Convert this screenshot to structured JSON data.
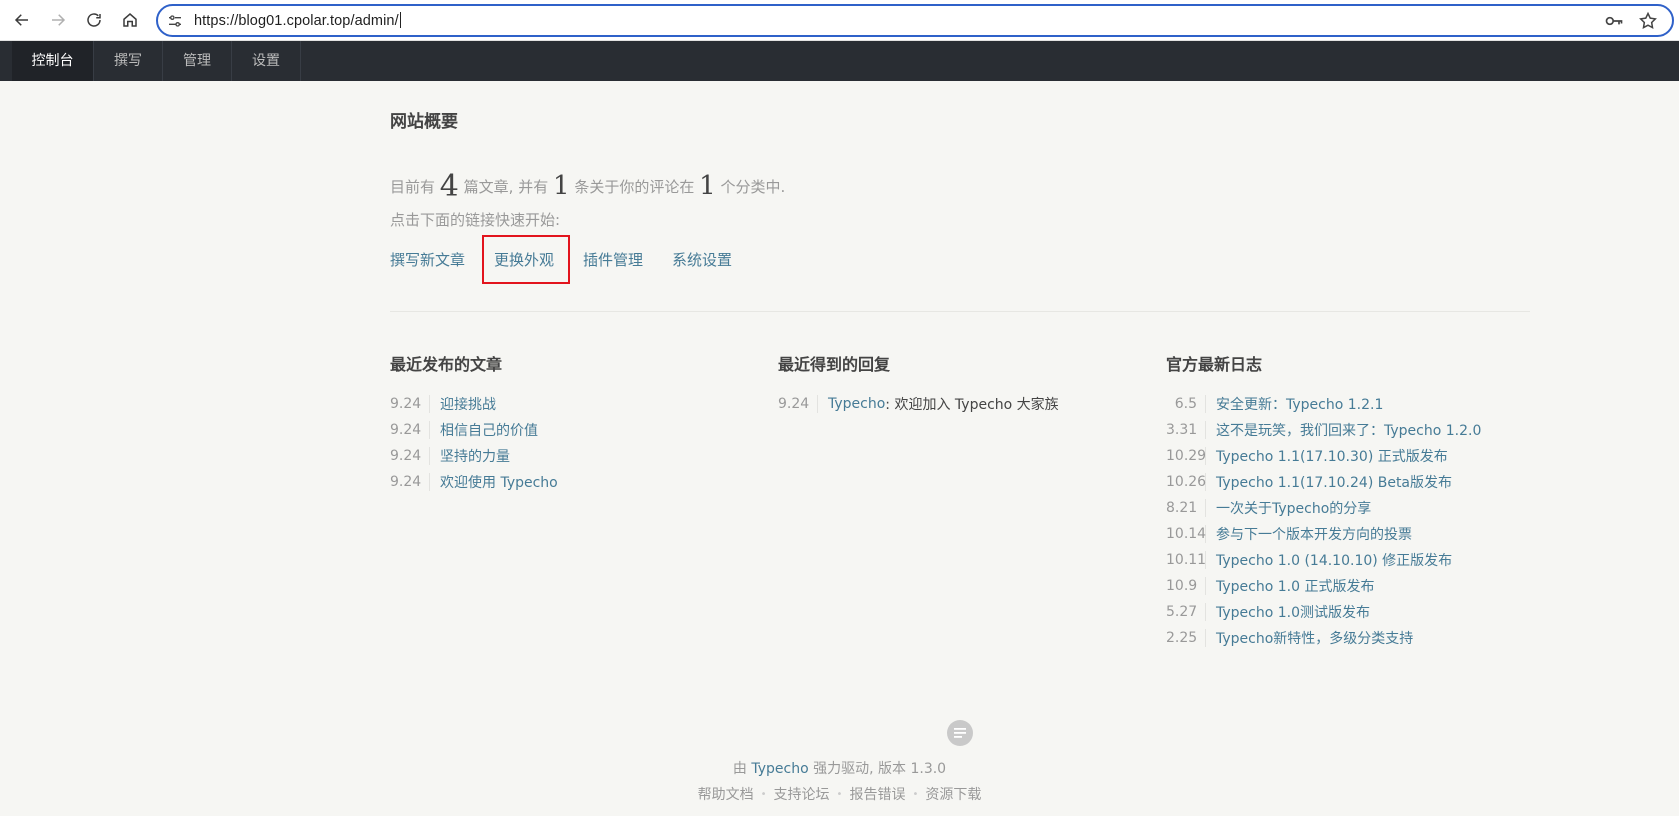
{
  "browser": {
    "url_label": "https://blog01.cpolar.top/admin/",
    "icons": [
      "back-icon",
      "forward-icon",
      "reload-icon",
      "home-icon",
      "site-settings-icon",
      "password-key-icon",
      "bookmark-star-icon"
    ]
  },
  "app_nav": {
    "tabs": [
      {
        "label": "控制台",
        "active": true
      },
      {
        "label": "撰写",
        "active": false
      },
      {
        "label": "管理",
        "active": false
      },
      {
        "label": "设置",
        "active": false
      }
    ]
  },
  "overview": {
    "title": "网站概要",
    "summary_prefix": "目前有",
    "post_count": "4",
    "summary_mid1": "篇文章, 并有",
    "comment_count": "1",
    "summary_mid2": "条关于你的评论在",
    "category_count": "1",
    "summary_suffix": "个分类中.",
    "hint": "点击下面的链接快速开始:",
    "quick_links": [
      "撰写新文章",
      "更换外观",
      "插件管理",
      "系统设置"
    ]
  },
  "recent_posts": {
    "title": "最近发布的文章",
    "items": [
      {
        "date": "9.24",
        "title": "迎接挑战"
      },
      {
        "date": "9.24",
        "title": "相信自己的价值"
      },
      {
        "date": "9.24",
        "title": "坚持的力量"
      },
      {
        "date": "9.24",
        "title": "欢迎使用 Typecho"
      }
    ]
  },
  "recent_replies": {
    "title": "最近得到的回复",
    "items": [
      {
        "date": "9.24",
        "author": "Typecho",
        "text": ": 欢迎加入 Typecho 大家族"
      }
    ]
  },
  "official_log": {
    "title": "官方最新日志",
    "items": [
      {
        "date": "6.5",
        "title": "安全更新：Typecho 1.2.1"
      },
      {
        "date": "3.31",
        "title": "这不是玩笑，我们回来了：Typecho 1.2.0"
      },
      {
        "date": "10.29",
        "title": "Typecho 1.1(17.10.30) 正式版发布"
      },
      {
        "date": "10.26",
        "title": "Typecho 1.1(17.10.24) Beta版发布"
      },
      {
        "date": "8.21",
        "title": "一次关于Typecho的分享"
      },
      {
        "date": "10.14",
        "title": "参与下一个版本开发方向的投票"
      },
      {
        "date": "10.11",
        "title": "Typecho 1.0 (14.10.10) 修正版发布"
      },
      {
        "date": "10.9",
        "title": "Typecho 1.0 正式版发布"
      },
      {
        "date": "5.27",
        "title": "Typecho 1.0测试版发布"
      },
      {
        "date": "2.25",
        "title": "Typecho新特性，多级分类支持"
      }
    ]
  },
  "footer": {
    "credit_prefix": "由",
    "credit_link": "Typecho",
    "credit_suffix": "强力驱动, 版本 1.3.0",
    "links": [
      "帮助文档",
      "支持论坛",
      "报告错误",
      "资源下载"
    ],
    "separator": "•"
  },
  "colors": {
    "link": "#467b96",
    "nav_bg": "#292d33",
    "page_bg": "#f6f6f3",
    "highlight": "#e2141d",
    "url_focus": "#2f61c9"
  }
}
